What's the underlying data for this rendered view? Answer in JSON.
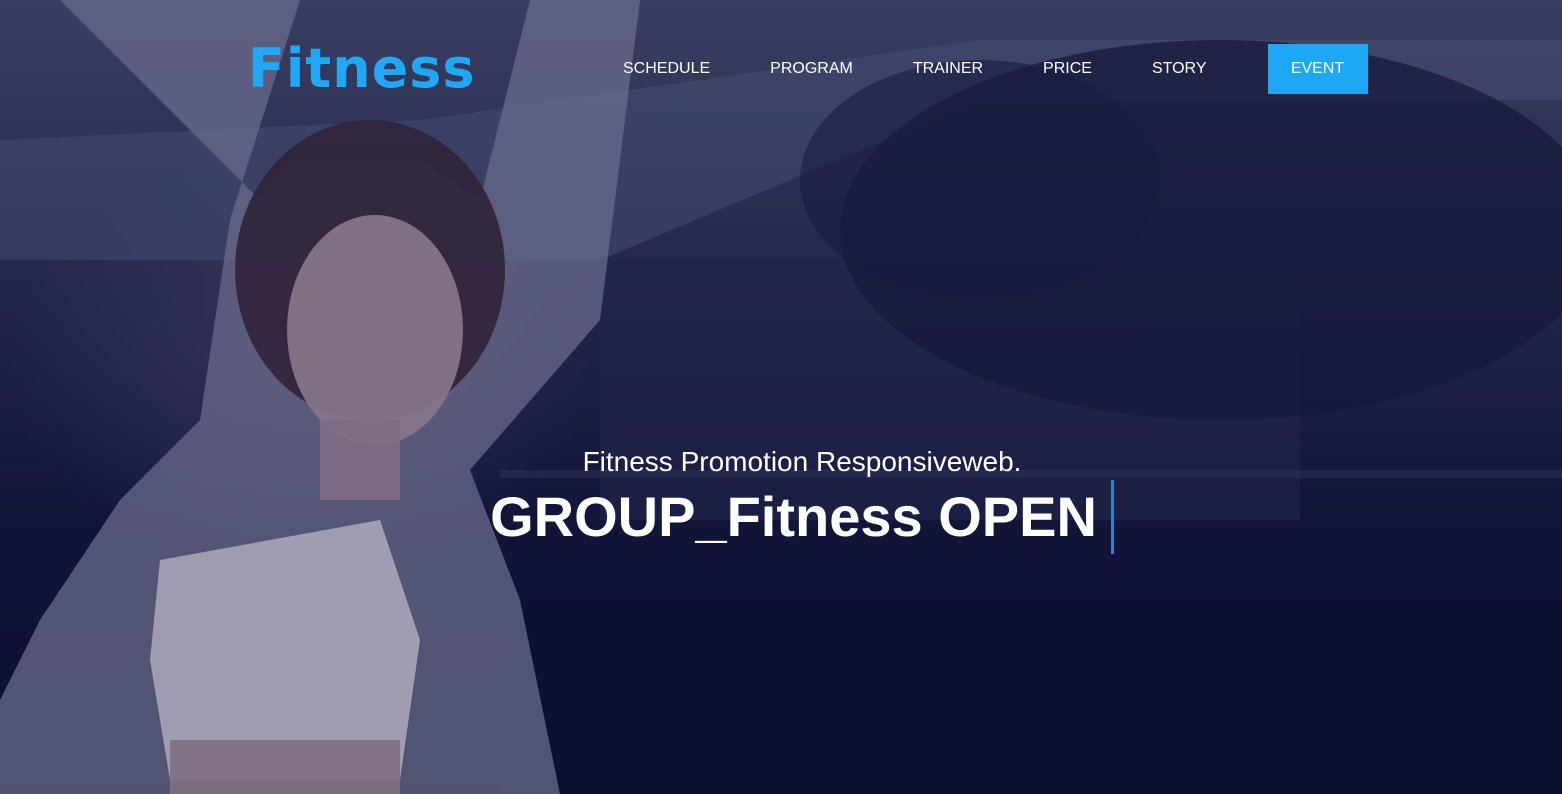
{
  "brand": {
    "logo_text": "Fitness",
    "accent_color": "#21a8f4"
  },
  "nav": {
    "items": [
      {
        "label": "SCHEDULE"
      },
      {
        "label": "PROGRAM"
      },
      {
        "label": "TRAINER"
      },
      {
        "label": "PRICE"
      },
      {
        "label": "STORY"
      }
    ],
    "cta_label": "EVENT",
    "cta_color": "#1ea7f5"
  },
  "hero": {
    "subtitle": "Fitness Promotion Responsiveweb.",
    "headline": "GROUP_Fitness OPEN",
    "background_image": "woman-stretching-photo"
  }
}
